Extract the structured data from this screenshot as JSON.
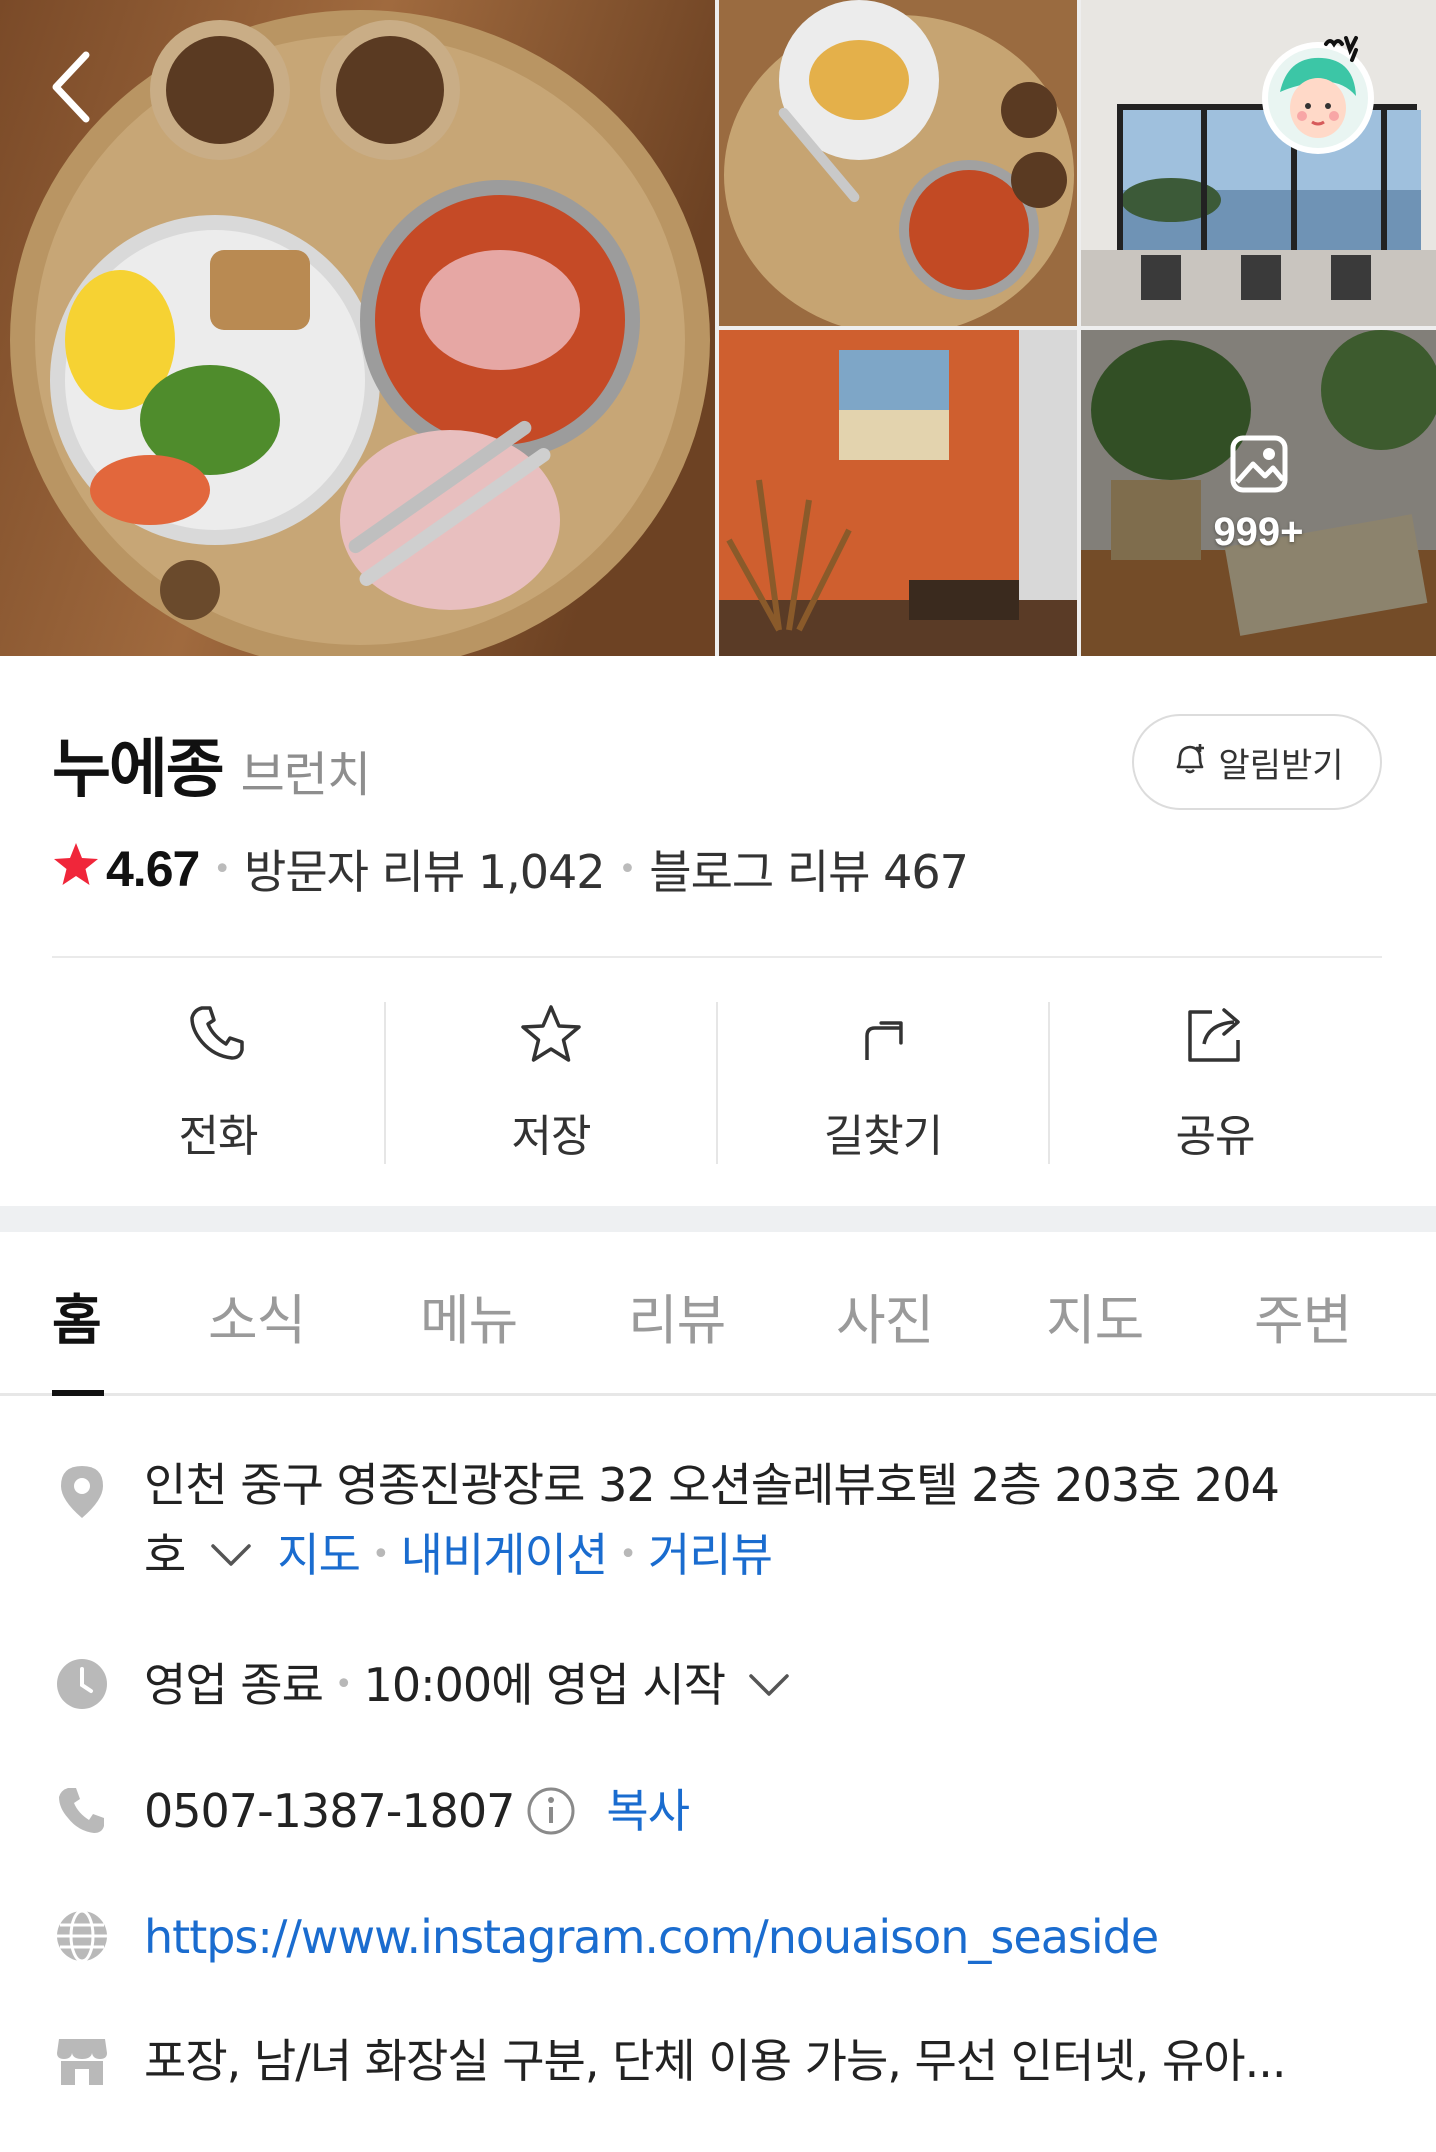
{
  "gallery": {
    "more_count": "999+"
  },
  "place": {
    "name": "누에종",
    "category": "브런치",
    "notify_label": "알림받기",
    "rating": "4.67",
    "visitor_reviews": "방문자 리뷰 1,042",
    "blog_reviews": "블로그 리뷰 467"
  },
  "actions": {
    "call": "전화",
    "save": "저장",
    "directions": "길찾기",
    "share": "공유"
  },
  "tabs": [
    "홈",
    "소식",
    "메뉴",
    "리뷰",
    "사진",
    "지도",
    "주변"
  ],
  "info": {
    "address_line1": "인천 중구 영종진광장로 32 오션솔레뷰호텔 2층 203호 204",
    "address_line2": "호",
    "map_link": "지도",
    "navigation_link": "내비게이션",
    "streetview_link": "거리뷰",
    "hours_status": "영업 종료",
    "hours_next": "10:00에 영업 시작",
    "phone": "0507-1387-1807",
    "copy_label": "복사",
    "website": "https://www.instagram.com/nouaison_seaside",
    "amenities": "포장, 남/녀 화장실 구분, 단체 이용 가능, 무선 인터넷, 유아..."
  },
  "colors": {
    "link": "#1a6ccf",
    "star": "#f0263a",
    "tab_active": "#111111",
    "tab_inactive": "#9a9a9a"
  }
}
